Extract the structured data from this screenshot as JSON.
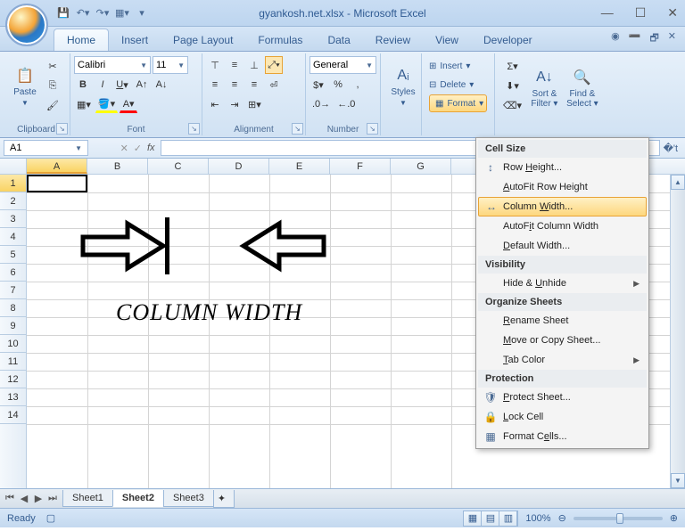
{
  "title": "gyankosh.net.xlsx - Microsoft Excel",
  "tabs": [
    "Home",
    "Insert",
    "Page Layout",
    "Formulas",
    "Data",
    "Review",
    "View",
    "Developer"
  ],
  "active_tab": 0,
  "clipboard": {
    "paste": "Paste",
    "label": "Clipboard"
  },
  "font": {
    "name": "Calibri",
    "size": "11",
    "label": "Font"
  },
  "alignment_label": "Alignment",
  "number": {
    "format": "General",
    "label": "Number"
  },
  "styles_label": "Styles",
  "cells": {
    "insert": "Insert",
    "delete": "Delete",
    "format": "Format"
  },
  "editing": {
    "sort": "Sort & Filter ▾",
    "find": "Find & Select ▾"
  },
  "namebox": "A1",
  "columns": [
    "A",
    "B",
    "C",
    "D",
    "E",
    "F",
    "G"
  ],
  "rows": [
    "1",
    "2",
    "3",
    "4",
    "5",
    "6",
    "7",
    "8",
    "9",
    "10",
    "11",
    "12",
    "13",
    "14"
  ],
  "worksheet_text": "COLUMN WIDTH",
  "sheets": [
    "Sheet1",
    "Sheet2",
    "Sheet3"
  ],
  "active_sheet": 1,
  "status": "Ready",
  "zoom": "100%",
  "format_menu": {
    "cell_size": "Cell Size",
    "row_height": "Row Height...",
    "autofit_row": "AutoFit Row Height",
    "col_width": "Column Width...",
    "autofit_col": "AutoFit Column Width",
    "default_width": "Default Width...",
    "visibility": "Visibility",
    "hide_unhide": "Hide & Unhide",
    "organize": "Organize Sheets",
    "rename": "Rename Sheet",
    "move_copy": "Move or Copy Sheet...",
    "tab_color": "Tab Color",
    "protection": "Protection",
    "protect_sheet": "Protect Sheet...",
    "lock_cell": "Lock Cell",
    "format_cells": "Format Cells..."
  }
}
